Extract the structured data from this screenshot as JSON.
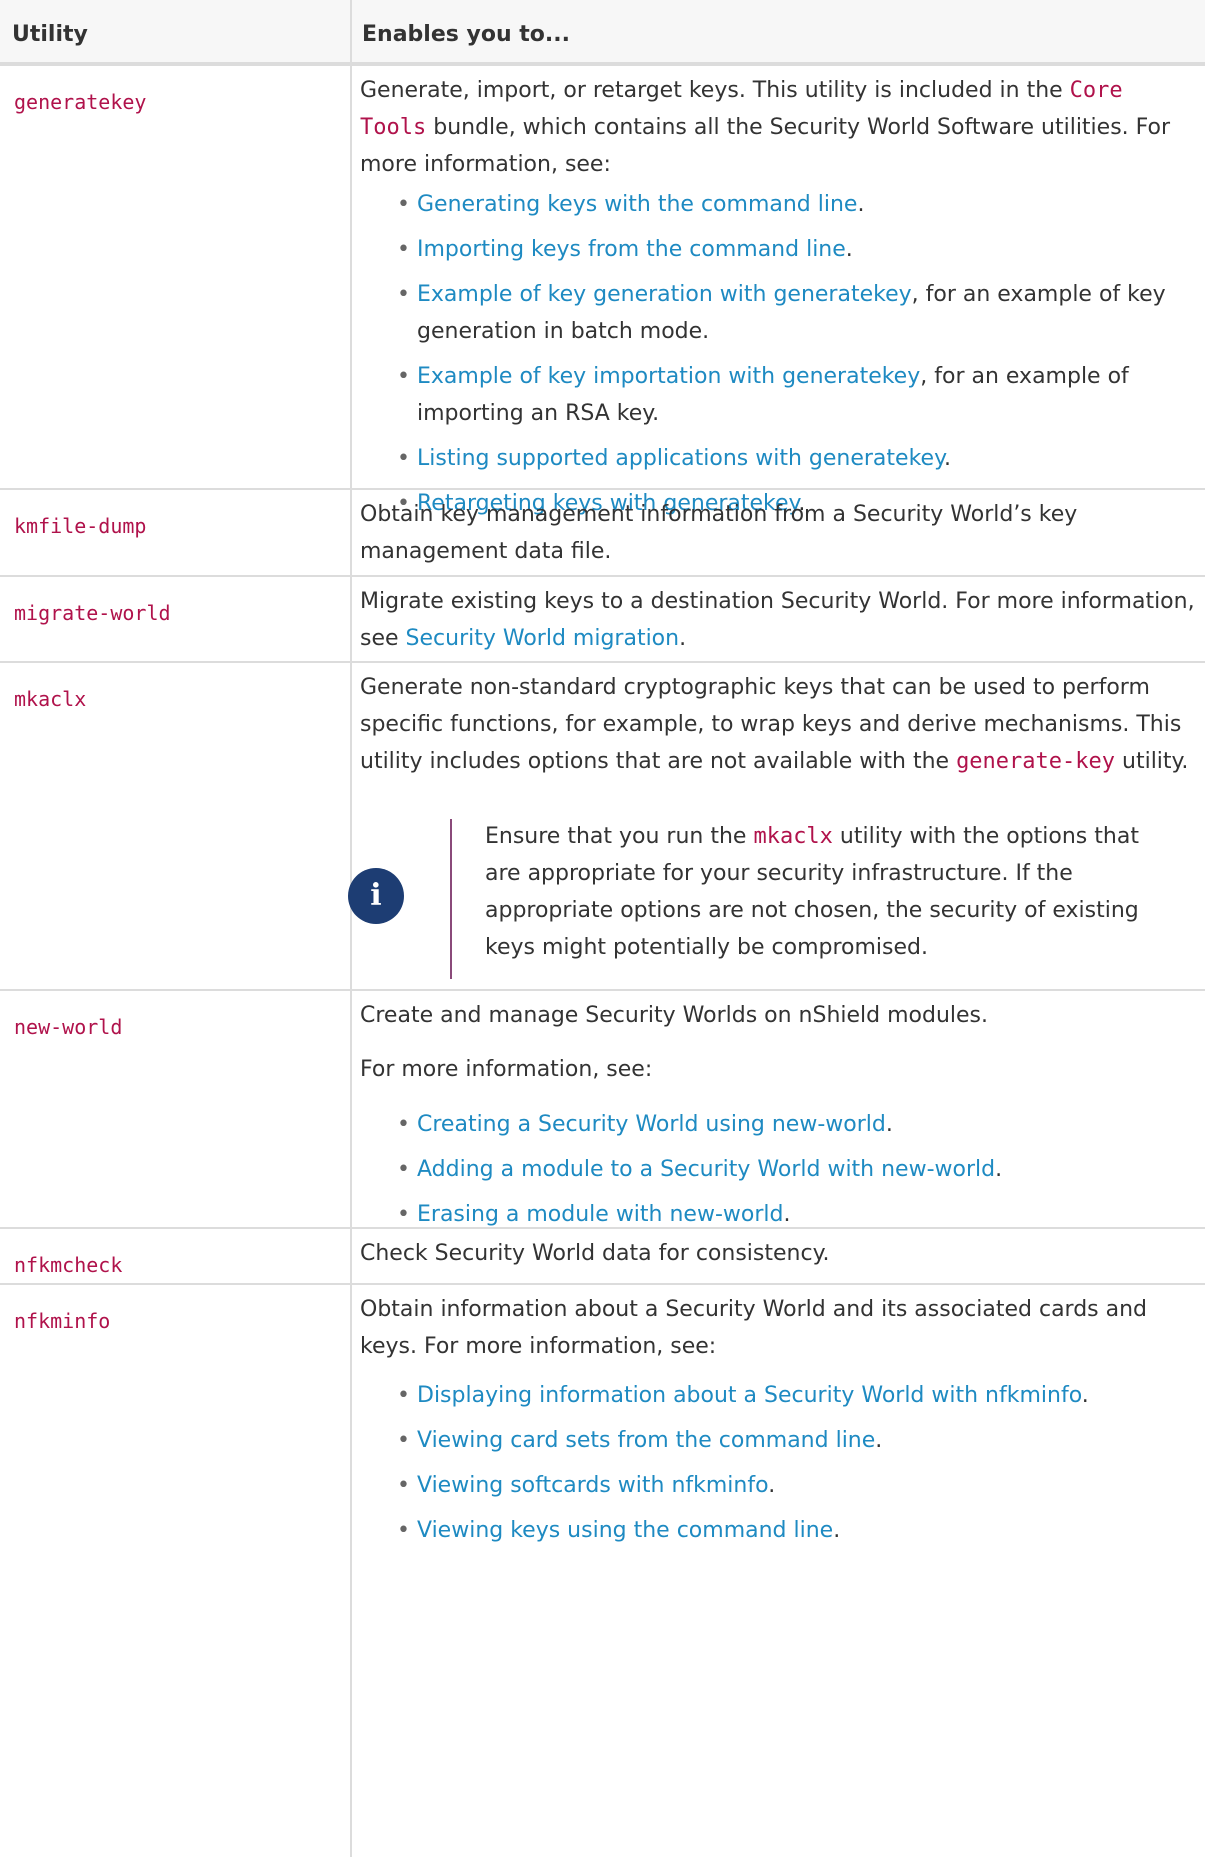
{
  "header": {
    "col1": "Utility",
    "col2": "Enables you to..."
  },
  "rows": {
    "generatekey": {
      "name": "generatekey",
      "text_before": "Generate, import, or retarget keys. This utility is included in the ",
      "code": "Core Tools",
      "text_after": " bundle, which contains all the Security World Software utilities. For more information, see:",
      "links": [
        {
          "link": "Generating keys with the command line",
          "suffix": "."
        },
        {
          "link": "Importing keys from the command line",
          "suffix": "."
        },
        {
          "link": "Example of key generation with generatekey",
          "suffix": ", for an example of key generation in batch mode."
        },
        {
          "link": "Example of key importation with generatekey",
          "suffix": ", for an example of importing an RSA key."
        },
        {
          "link": "Listing supported applications with generatekey",
          "suffix": "."
        },
        {
          "link": "Retargeting keys with generatekey",
          "suffix": "."
        }
      ]
    },
    "kmfile_dump": {
      "name": "kmfile-dump",
      "text": "Obtain key management information from a Security World’s key management data file."
    },
    "migrate_world": {
      "name": "migrate-world",
      "text": "Migrate existing keys to a destination Security World. For more information, see ",
      "link": "Security World migration",
      "suffix": "."
    },
    "mkaclx": {
      "name": "mkaclx",
      "text_before": "Generate non-standard cryptographic keys that can be used to perform specific functions, for example, to wrap keys and derive mechanisms. This utility includes options that are not available with the ",
      "code": "generate-key",
      "text_after": " utility.",
      "note": {
        "icon": "info-icon",
        "icon_glyph": "i",
        "text_before": "Ensure that you run the ",
        "code": "mkaclx",
        "text_after": " utility with the options that are appropriate for your security infrastructure. If the appropriate options are not chosen, the security of existing keys might potentially be compromised."
      }
    },
    "new_world": {
      "name": "new-world",
      "text1": "Create and manage Security Worlds on nShield modules.",
      "text2": "For more information, see:",
      "links": [
        {
          "link": "Creating a Security World using new-world",
          "suffix": "."
        },
        {
          "link": "Adding a module to a Security World with new-world",
          "suffix": "."
        },
        {
          "link": "Erasing a module with new-world",
          "suffix": "."
        }
      ]
    },
    "nfkmcheck": {
      "name": "nfkmcheck",
      "text": "Check Security World data for consistency."
    },
    "nfkminfo": {
      "name": "nfkminfo",
      "text": "Obtain information about a Security World and its associated cards and keys. For more information, see:",
      "links": [
        {
          "link": "Displaying information about a Security World with nfkminfo",
          "suffix": "."
        },
        {
          "link": "Viewing card sets from the command line",
          "suffix": "."
        },
        {
          "link": "Viewing softcards with nfkminfo",
          "suffix": "."
        },
        {
          "link": "Viewing keys using the command line",
          "suffix": "."
        }
      ]
    }
  }
}
